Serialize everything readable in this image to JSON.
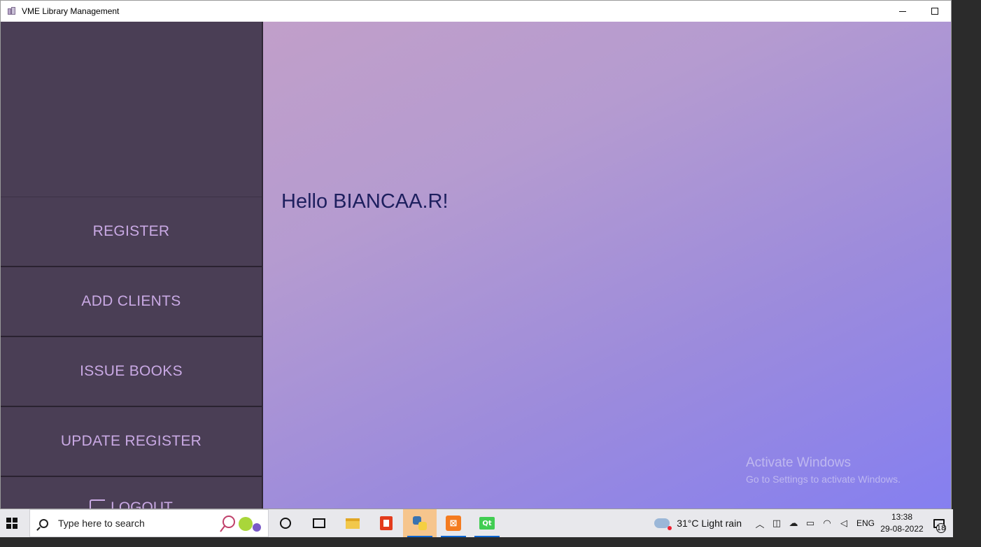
{
  "window": {
    "title": "VME Library Management",
    "minimize_label": "–",
    "maximize_label": "□"
  },
  "sidebar": {
    "items": [
      {
        "label": "REGISTER"
      },
      {
        "label": "ADD CLIENTS"
      },
      {
        "label": "ISSUE BOOKS"
      },
      {
        "label": "UPDATE REGISTER"
      },
      {
        "label": "LOGOUT"
      }
    ]
  },
  "main": {
    "greeting": "Hello BIANCAA.R!"
  },
  "watermark": {
    "line1": "Activate Windows",
    "line2": "Go to Settings to activate Windows."
  },
  "taskbar": {
    "search_placeholder": "Type here to search",
    "apps": [
      "cortana-icon",
      "task-view-icon",
      "file-explorer-icon",
      "office-icon",
      "python-icon",
      "xampp-icon",
      "qt-icon"
    ],
    "weather": "31°C  Light rain",
    "language": "ENG",
    "time": "13:38",
    "date": "29-08-2022",
    "notifications": "18"
  },
  "colors": {
    "sidebar_bg": "#4a3e55",
    "sidebar_text": "#c9a9e4",
    "greeting_text": "#1d1f5e",
    "gradient_start": "#c19fc9",
    "gradient_end": "#857ff0"
  }
}
